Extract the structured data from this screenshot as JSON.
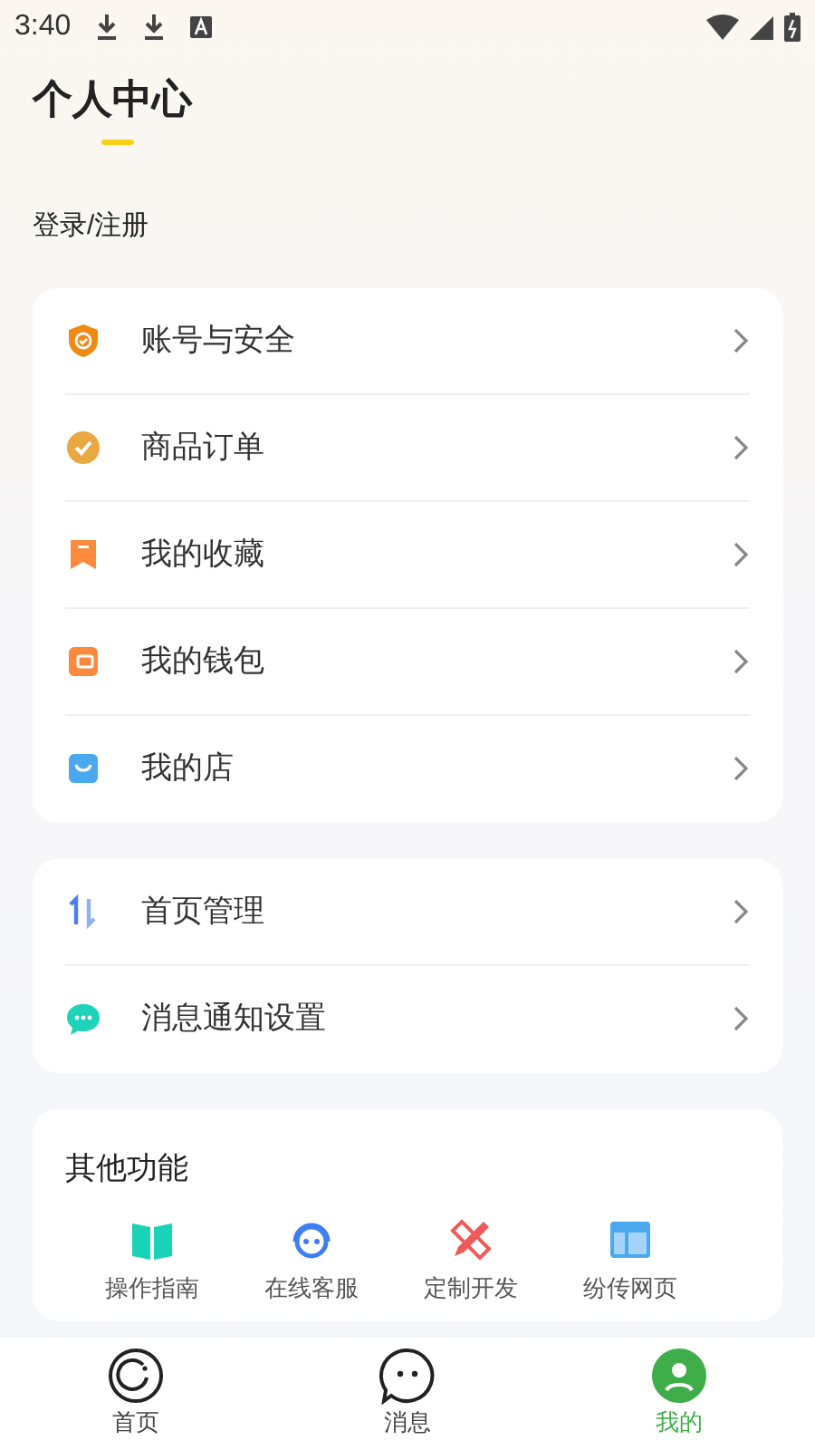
{
  "status_bar": {
    "time": "3:40"
  },
  "title": "个人中心",
  "login": "登录/注册",
  "menu_groups": [
    {
      "items": [
        {
          "label": "账号与安全",
          "kind": "shield"
        },
        {
          "label": "商品订单",
          "kind": "check"
        },
        {
          "label": "我的收藏",
          "kind": "bookmark"
        },
        {
          "label": "我的钱包",
          "kind": "wallet"
        },
        {
          "label": "我的店",
          "kind": "bag"
        }
      ]
    },
    {
      "items": [
        {
          "label": "首页管理",
          "kind": "sort"
        },
        {
          "label": "消息通知设置",
          "kind": "chat"
        }
      ]
    }
  ],
  "other": {
    "title": "其他功能",
    "items": [
      {
        "label": "操作指南",
        "kind": "book"
      },
      {
        "label": "在线客服",
        "kind": "headset"
      },
      {
        "label": "定制开发",
        "kind": "pencil"
      },
      {
        "label": "纷传网页",
        "kind": "layout"
      }
    ]
  },
  "nav": [
    {
      "label": "首页",
      "kind": "home",
      "selected": false
    },
    {
      "label": "消息",
      "kind": "msg",
      "selected": false
    },
    {
      "label": "我的",
      "kind": "me",
      "selected": true
    }
  ]
}
